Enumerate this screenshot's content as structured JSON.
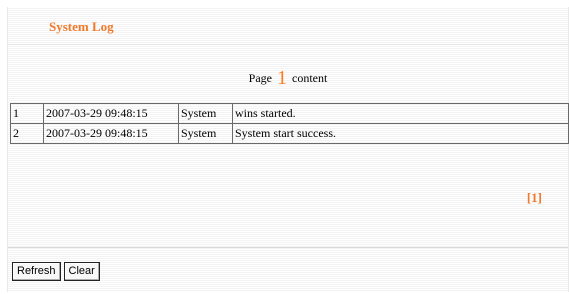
{
  "title": "System Log",
  "page_header": {
    "prefix": "Page",
    "number": "1",
    "suffix": "content"
  },
  "log": {
    "rows": [
      {
        "no": "1",
        "time": "2007-03-29 09:48:15",
        "source": "System",
        "message": "wins started."
      },
      {
        "no": "2",
        "time": "2007-03-29 09:48:15",
        "source": "System",
        "message": "System start success."
      }
    ]
  },
  "pager": {
    "label": "[1]"
  },
  "buttons": {
    "refresh": "Refresh",
    "clear": "Clear"
  },
  "colors": {
    "accent": "#f07a2c",
    "page_number": "#ff7a1a"
  }
}
